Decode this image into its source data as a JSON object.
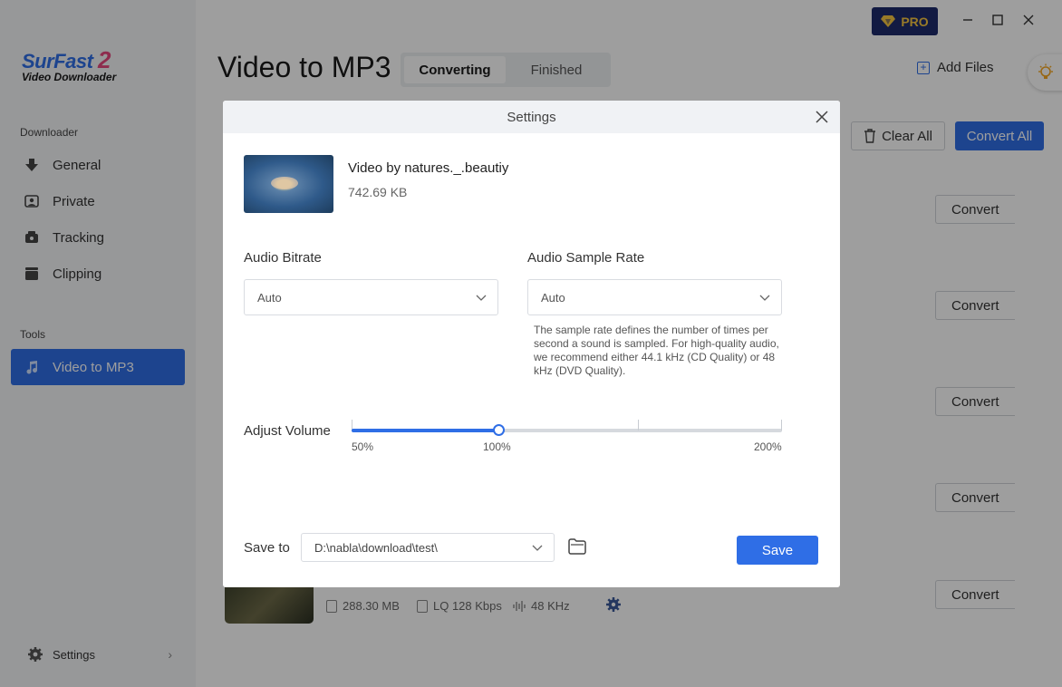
{
  "sidebar": {
    "logo_brand": "SurFast",
    "logo_number": "2",
    "logo_sub": "Video Downloader",
    "section_downloader": "Downloader",
    "items": [
      {
        "label": "General"
      },
      {
        "label": "Private"
      },
      {
        "label": "Tracking"
      },
      {
        "label": "Clipping"
      }
    ],
    "section_tools": "Tools",
    "tool_items": [
      {
        "label": "Video to MP3"
      }
    ],
    "settings_label": "Settings",
    "settings_chevron": "›"
  },
  "header": {
    "title": "Video to MP3",
    "tabs": [
      {
        "label": "Converting"
      },
      {
        "label": "Finished"
      }
    ],
    "pro_label": "PRO",
    "add_files_label": "Add Files",
    "clear_all_label": "Clear All",
    "convert_all_label": "Convert All"
  },
  "list": {
    "convert_label": "Convert",
    "last_item": {
      "size": "288.30 MB",
      "quality": "LQ 128 Kbps",
      "sample_rate": "48 KHz"
    }
  },
  "dialog": {
    "title": "Settings",
    "file_name": "Video by natures._.beautiy",
    "file_size": "742.69 KB",
    "bitrate_label": "Audio Bitrate",
    "bitrate_value": "Auto",
    "samplerate_label": "Audio Sample Rate",
    "samplerate_value": "Auto",
    "samplerate_hint": "The sample rate defines the number of times per second a sound is sampled. For high-quality audio, we recommend either 44.1 kHz (CD Quality) or 48 kHz (DVD Quality).",
    "volume_label": "Adjust Volume",
    "volume": {
      "min_label": "50%",
      "mid_label": "100%",
      "max_label": "200%",
      "value_fraction": 0.34
    },
    "save_to_label": "Save to",
    "save_path": "D:\\nabla\\download\\test\\",
    "save_button": "Save"
  },
  "colors": {
    "accent": "#2f6ee6",
    "pro_bg": "#1d2b6b",
    "pro_text": "#f5c542"
  }
}
